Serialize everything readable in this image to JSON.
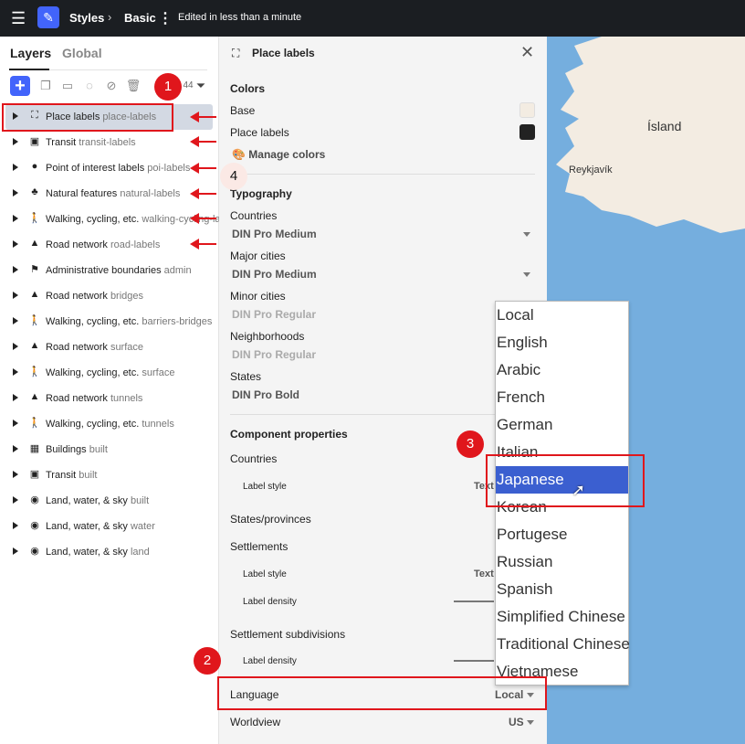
{
  "topbar": {
    "crumb_styles": "Styles",
    "crumb_style_name": "Basic",
    "edited": "Edited in less than a minute"
  },
  "left": {
    "tab_layers": "Layers",
    "tab_global": "Global",
    "layer_count": "44",
    "layers": [
      {
        "name": "Place labels",
        "id": "place-labels",
        "icon": "place-icon"
      },
      {
        "name": "Transit",
        "id": "transit-labels",
        "icon": "transit-icon"
      },
      {
        "name": "Point of interest labels",
        "id": "poi-labels",
        "icon": "pin-icon"
      },
      {
        "name": "Natural features",
        "id": "natural-labels",
        "icon": "tree-icon"
      },
      {
        "name": "Walking, cycling, etc.",
        "id": "walking-cycling-la",
        "icon": "walker-icon"
      },
      {
        "name": "Road network",
        "id": "road-labels",
        "icon": "road-icon"
      },
      {
        "name": "Administrative boundaries",
        "id": "admin",
        "icon": "flag-icon"
      },
      {
        "name": "Road network",
        "id": "bridges",
        "icon": "road-icon"
      },
      {
        "name": "Walking, cycling, etc.",
        "id": "barriers-bridges",
        "icon": "walker-icon"
      },
      {
        "name": "Road network",
        "id": "surface",
        "icon": "road-icon"
      },
      {
        "name": "Walking, cycling, etc.",
        "id": "surface",
        "icon": "walker-icon"
      },
      {
        "name": "Road network",
        "id": "tunnels",
        "icon": "road-icon"
      },
      {
        "name": "Walking, cycling, etc.",
        "id": "tunnels",
        "icon": "walker-icon"
      },
      {
        "name": "Buildings",
        "id": "built",
        "icon": "building-icon"
      },
      {
        "name": "Transit",
        "id": "built",
        "icon": "transit-icon"
      },
      {
        "name": "Land, water, & sky",
        "id": "built",
        "icon": "globe-icon"
      },
      {
        "name": "Land, water, & sky",
        "id": "water",
        "icon": "globe-icon"
      },
      {
        "name": "Land, water, & sky",
        "id": "land",
        "icon": "globe-icon"
      }
    ]
  },
  "panel": {
    "title": "Place labels",
    "colors_heading": "Colors",
    "base_label": "Base",
    "base_color": "#f3ece2",
    "place_labels_label": "Place labels",
    "place_labels_color": "#222222",
    "manage_colors": "Manage colors",
    "typography_heading": "Typography",
    "countries_label": "Countries",
    "countries_font": "DIN Pro Medium",
    "major_cities_label": "Major cities",
    "major_cities_font": "DIN Pro Medium",
    "minor_cities_label": "Minor cities",
    "minor_cities_font": "DIN Pro Regular",
    "neighborhoods_label": "Neighborhoods",
    "neighborhoods_font": "DIN Pro Regular",
    "states_label": "States",
    "states_font": "DIN Pro Bold",
    "component_heading": "Component properties",
    "cp_countries": "Countries",
    "cp_label_style": "Label style",
    "cp_label_style_value": "Text",
    "cp_states": "States/provinces",
    "cp_settlements": "Settlements",
    "cp_settlements_label_style": "Label style",
    "cp_settlements_label_style_value": "Text",
    "cp_label_density": "Label density",
    "cp_settlement_subdivisions": "Settlement subdivisions",
    "cp_subdiv_density": "Label density",
    "language_label": "Language",
    "language_value": "Local",
    "worldview_label": "Worldview",
    "worldview_value": "US"
  },
  "map": {
    "country_label": "Ísland",
    "city_label": "Reykjavík",
    "water_color": "#75aede",
    "land_color": "#f3ece2"
  },
  "language_options": [
    "Local",
    "English",
    "Arabic",
    "French",
    "German",
    "Italian",
    "Japanese",
    "Korean",
    "Portugese",
    "Russian",
    "Spanish",
    "Simplified Chinese",
    "Traditional Chinese",
    "Vietnamese"
  ],
  "language_highlighted": "Japanese",
  "annotations": {
    "badge1": "1",
    "badge2": "2",
    "badge3": "3",
    "badge4": "4"
  }
}
